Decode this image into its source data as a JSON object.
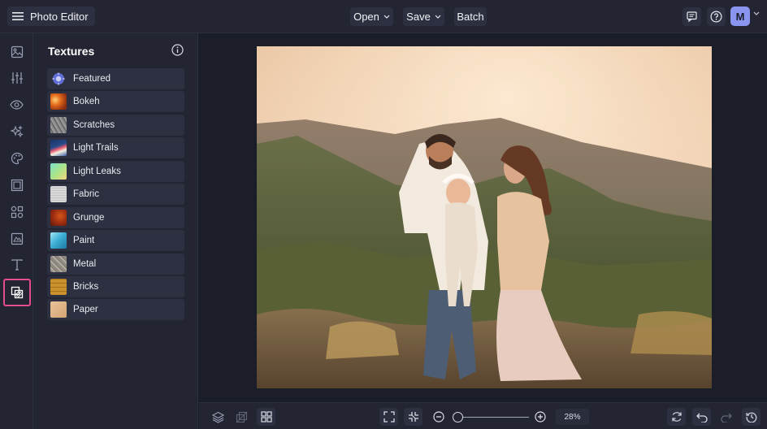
{
  "app": {
    "title": "Photo Editor",
    "menu_icon": "hamburger-icon"
  },
  "toolbar": {
    "open_label": "Open",
    "save_label": "Save",
    "batch_label": "Batch",
    "dropdown_icon": "chevron-down-icon",
    "right_icons": [
      "comment-icon",
      "help-icon"
    ],
    "avatar_initial": "M",
    "avatar_color": "#8a95f0"
  },
  "rail": {
    "items": [
      {
        "icon": "image-icon"
      },
      {
        "icon": "sliders-icon"
      },
      {
        "icon": "eye-icon"
      },
      {
        "icon": "sparkles-icon"
      },
      {
        "icon": "palette-icon"
      },
      {
        "icon": "frame-icon"
      },
      {
        "icon": "shapes-icon"
      },
      {
        "icon": "graphics-icon"
      },
      {
        "icon": "text-icon"
      },
      {
        "icon": "textures-icon",
        "active": true
      }
    ],
    "active_color": "#e44d8a"
  },
  "panel": {
    "title": "Textures",
    "info_icon": "info-icon",
    "items": [
      {
        "label": "Featured"
      },
      {
        "label": "Bokeh"
      },
      {
        "label": "Scratches"
      },
      {
        "label": "Light Trails"
      },
      {
        "label": "Light Leaks"
      },
      {
        "label": "Fabric"
      },
      {
        "label": "Grunge"
      },
      {
        "label": "Paint"
      },
      {
        "label": "Metal"
      },
      {
        "label": "Bricks"
      },
      {
        "label": "Paper"
      }
    ]
  },
  "bottombar": {
    "zoom_value": "28%",
    "zoom_level": 0.28,
    "left_icons": [
      "layers-icon",
      "crop-layers-icon",
      "grid-icon"
    ],
    "center_icons": [
      "fit-screen-icon",
      "actual-size-icon",
      "zoom-out-icon",
      "zoom-in-icon"
    ],
    "right_icons": [
      "reset-icon",
      "undo-icon",
      "redo-icon",
      "history-icon"
    ]
  }
}
